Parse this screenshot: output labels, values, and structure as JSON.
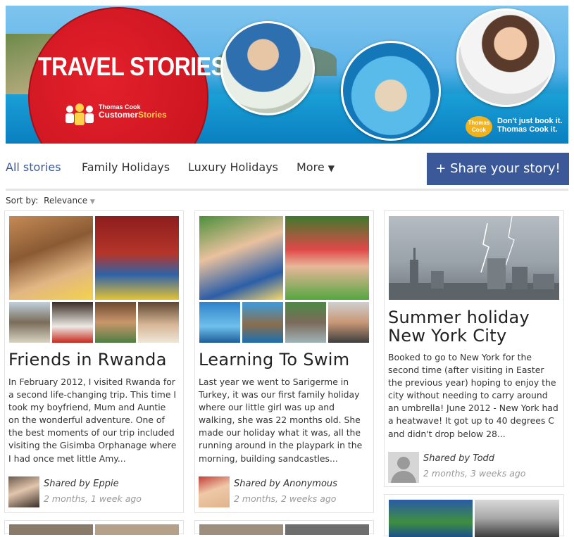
{
  "banner": {
    "title": "TRAVEL STORIES",
    "brand_small": "Thomas Cook",
    "brand_customer": "Customer",
    "brand_stories": "Stories",
    "logo_text": "Thomas Cook",
    "slogan_line1": "Don't just book it.",
    "slogan_line2": "Thomas Cook it.",
    "colors": {
      "badge_red": "#c4121c",
      "brand_yellow": "#f2b21b"
    }
  },
  "nav": {
    "items": [
      {
        "label": "All stories",
        "active": true
      },
      {
        "label": "Family Holidays",
        "active": false
      },
      {
        "label": "Luxury Holidays",
        "active": false
      },
      {
        "label": "More",
        "active": false
      }
    ],
    "more_caret": "▼",
    "share_icon": "+",
    "share_label": "Share your story!",
    "accent": "#3b5998"
  },
  "sort": {
    "label": "Sort by:",
    "selected": "Relevance",
    "caret": "▼"
  },
  "cards": [
    {
      "title": "Friends in Rwanda",
      "body": "In February 2012, I visited Rwanda for a second life-changing trip. This time I took my boyfriend, Mum and Auntie on the wonderful adventure. One of the best moments of our trip included visiting the Gisimba Orphanage where I had once met little Amy...",
      "shared_by": "Shared by Eppie",
      "age": "2 months, 1 week ago"
    },
    {
      "title": "Learning To Swim",
      "body": "Last year we went to Sarigerme in Turkey, it was our first family holiday where our little girl was up and walking, she was 22 months old. She made our holiday what it was, all the running around in the playpark in the morning, building sandcastles...",
      "shared_by": "Shared by Anonymous",
      "age": "2 months, 2 weeks ago"
    },
    {
      "title_line1": "Summer holiday",
      "title_line2": "New York City",
      "body": "Booked to go to New York for the second time (after visiting in Easter the previous year) hoping to enjoy the city without needing to carry around an umbrella! June 2012 - New York had a heatwave! It got up to 40 degrees C and didn't drop below 28...",
      "shared_by": "Shared by Todd",
      "age": "2 months, 3 weeks ago"
    }
  ]
}
